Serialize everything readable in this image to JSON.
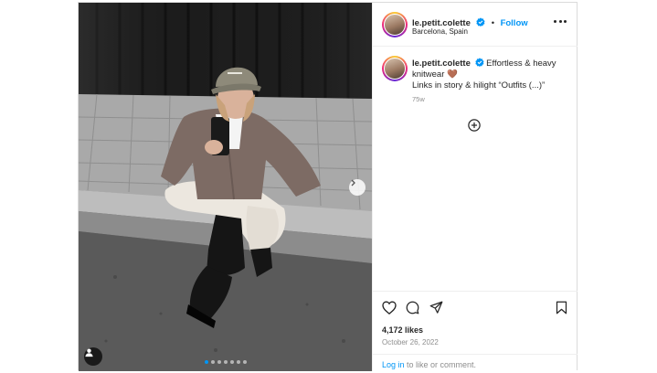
{
  "post": {
    "username": "le.petit.colette",
    "follow_label": "Follow",
    "location": "Barcelona, Spain",
    "caption": {
      "username": "le.petit.colette",
      "line1": "Effortless & heavy",
      "line2": "knitwear 🤎",
      "line3": "Links in story & hilight “Outfits (...)”",
      "time": "75w"
    },
    "likes": "4,172 likes",
    "date": "October 26, 2022",
    "login_link": "Log in",
    "login_suffix": " to like or comment.",
    "carousel": {
      "slide_count": 7,
      "active_index": 0
    }
  },
  "icons": {
    "verified": "verified-badge-icon",
    "more": "more-options-icon",
    "next": "chevron-right-icon",
    "tag": "user-tag-icon",
    "plus": "add-comment-icon",
    "like": "heart-icon",
    "comment": "comment-icon",
    "share": "share-icon",
    "save": "bookmark-icon"
  },
  "colors": {
    "accent": "#0095f6",
    "text": "#262626",
    "secondary": "#8e8e8e",
    "border": "#dbdbdb"
  }
}
